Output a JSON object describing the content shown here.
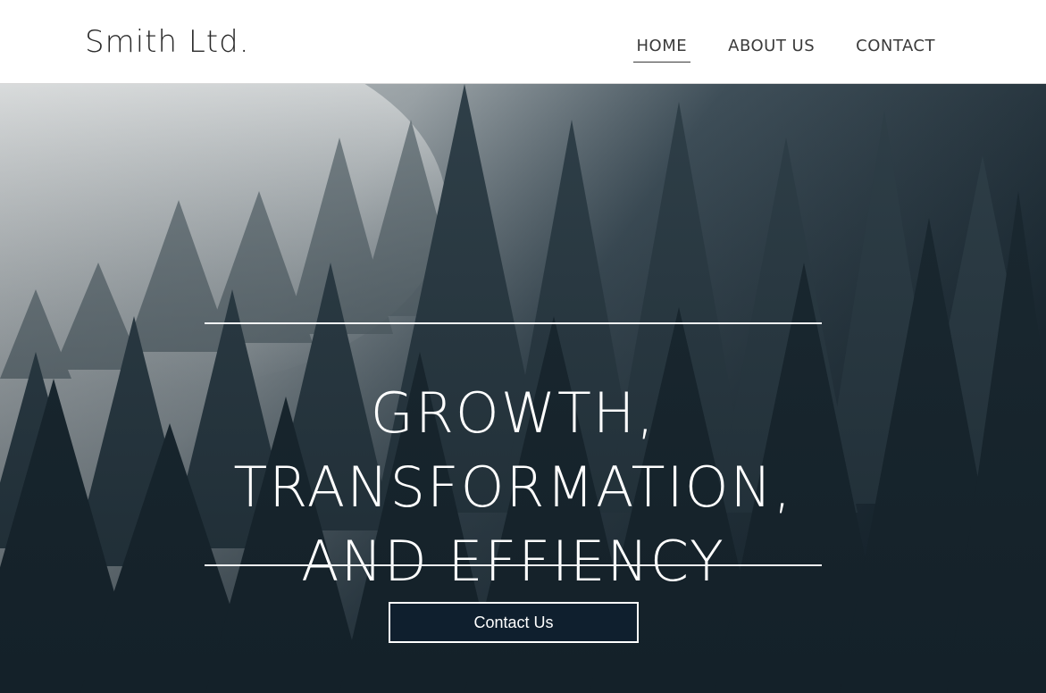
{
  "header": {
    "logo": "Smith Ltd.",
    "nav": [
      {
        "label": "HOME",
        "active": true
      },
      {
        "label": "ABOUT US",
        "active": false
      },
      {
        "label": "CONTACT",
        "active": false
      }
    ]
  },
  "hero": {
    "headline_lines": [
      "GROWTH,",
      "TRANSFORMATION,",
      "AND EFFIENCY"
    ],
    "cta_label": "Contact Us",
    "background": "misty-pine-forest-image"
  },
  "colors": {
    "header_bg": "#ffffff",
    "text_dark": "#2a2a2a",
    "hero_text": "#ffffff",
    "cta_bg": "#0f1f2e"
  }
}
